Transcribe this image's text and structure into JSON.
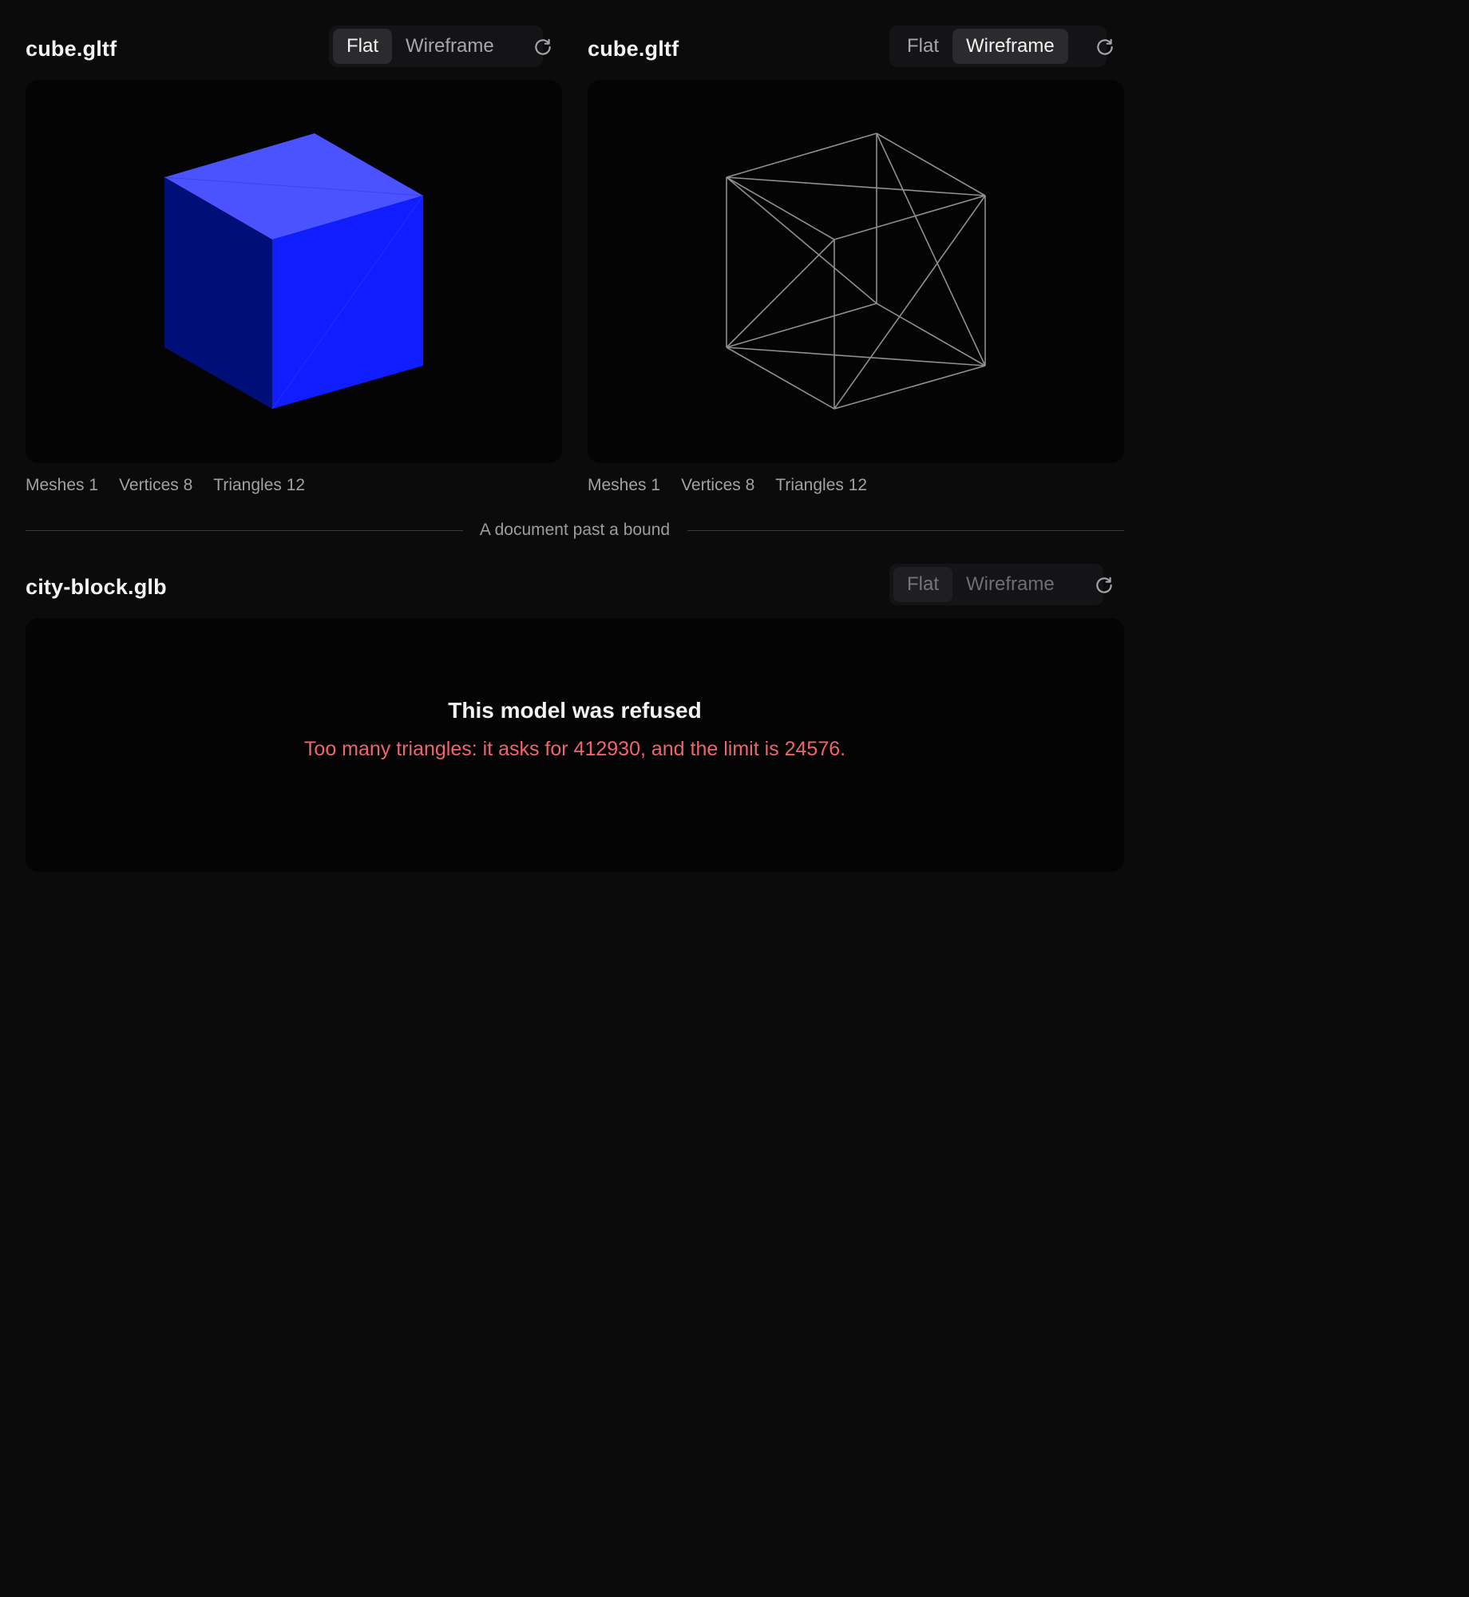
{
  "panels": [
    {
      "filename": "cube.gltf",
      "modes": [
        "Flat",
        "Wireframe"
      ],
      "active_mode": "Flat",
      "stats": [
        {
          "label": "Meshes",
          "value": "1"
        },
        {
          "label": "Vertices",
          "value": "8"
        },
        {
          "label": "Triangles",
          "value": "12"
        }
      ]
    },
    {
      "filename": "cube.gltf",
      "modes": [
        "Flat",
        "Wireframe"
      ],
      "active_mode": "Wireframe",
      "stats": [
        {
          "label": "Meshes",
          "value": "1"
        },
        {
          "label": "Vertices",
          "value": "8"
        },
        {
          "label": "Triangles",
          "value": "12"
        }
      ]
    }
  ],
  "divider_label": "A document past a bound",
  "refused_panel": {
    "filename": "city-block.glb",
    "modes": [
      "Flat",
      "Wireframe"
    ],
    "active_mode": "Flat",
    "title": "This model was refused",
    "message": "Too many triangles: it asks for 412930, and the limit is 24576."
  },
  "icons": {
    "reload": "reload-icon"
  },
  "colors": {
    "background": "#0b0b0c",
    "viewport": "#040405",
    "cube_top": "#4a53ff",
    "cube_left": "#000e78",
    "cube_right": "#0f1dff",
    "wireframe": "#8f8f93",
    "error": "#f0646c"
  }
}
